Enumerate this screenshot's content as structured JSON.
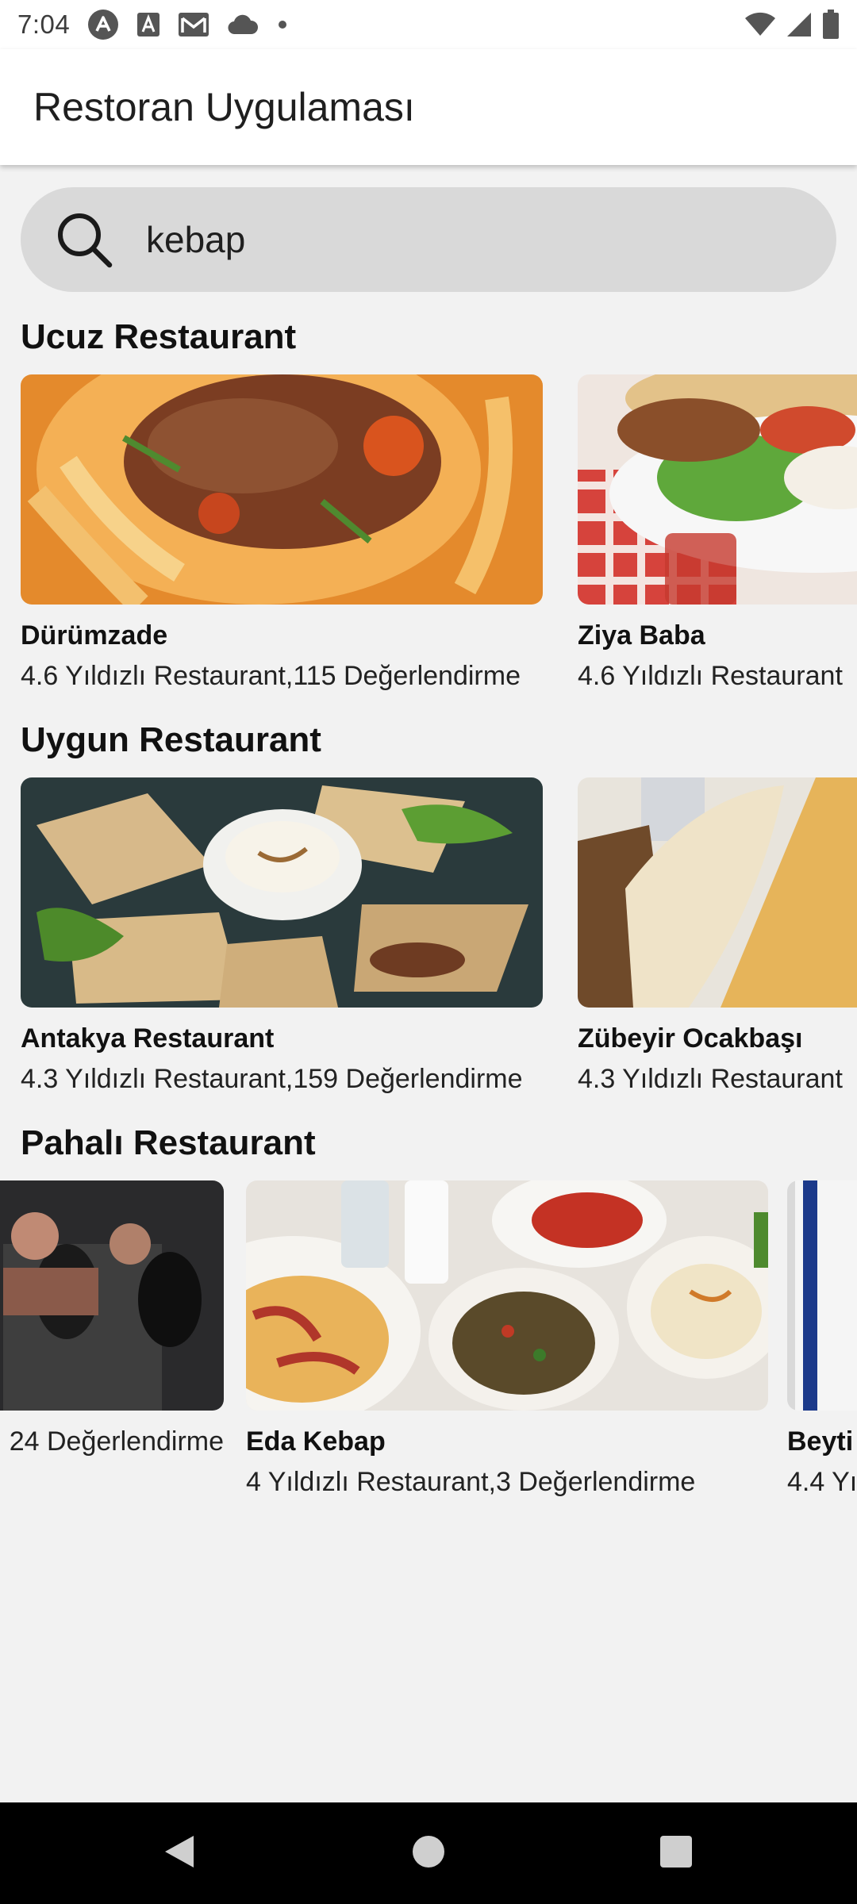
{
  "status_bar": {
    "time": "7:04",
    "icons": [
      "arc-icon",
      "text-a-icon",
      "gmail-icon",
      "cloud-icon",
      "dot-icon"
    ],
    "right_icons": [
      "wifi-icon",
      "signal-icon",
      "battery-icon"
    ]
  },
  "app_bar": {
    "title": "Restoran Uygulaması"
  },
  "search": {
    "value": "kebap",
    "icon": "search-icon"
  },
  "sections": [
    {
      "title": "Ucuz Restaurant",
      "cards": [
        {
          "name": "Dürümzade",
          "info": "4.6 Yıldızlı Restaurant,115 Değerlendirme"
        },
        {
          "name": "Ziya Baba",
          "info": "4.6 Yıldızlı Restaurant"
        }
      ]
    },
    {
      "title": "Uygun Restaurant",
      "cards": [
        {
          "name": "Antakya Restaurant",
          "info": "4.3 Yıldızlı Restaurant,159 Değerlendirme"
        },
        {
          "name": "Zübeyir Ocakbaşı",
          "info": "4.3 Yıldızlı Restaurant"
        }
      ]
    },
    {
      "title": "Pahalı Restaurant",
      "cards": [
        {
          "name": "",
          "info": "24 Değerlendirme"
        },
        {
          "name": "Eda Kebap",
          "info": "4 Yıldızlı Restaurant,3 Değerlendirme"
        },
        {
          "name": "Beyti",
          "info": "4.4 Yı"
        }
      ]
    }
  ],
  "nav_bar": {
    "buttons": [
      "back-icon",
      "home-icon",
      "recents-icon"
    ]
  },
  "colors": {
    "background": "#f2f2f2",
    "search_bg": "#d9d9d9",
    "appbar_bg": "#ffffff",
    "navbar_bg": "#000000"
  }
}
